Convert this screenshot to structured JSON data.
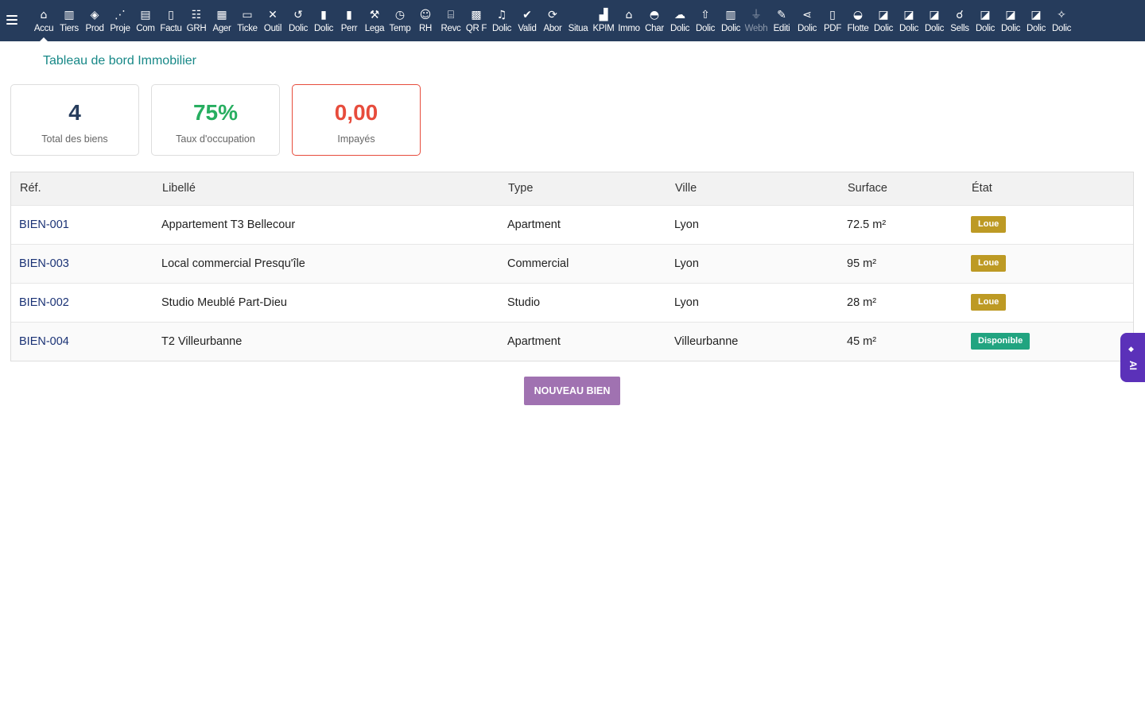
{
  "topbar": {
    "colors": {
      "background": "#263c5c",
      "icon": "#ffffff"
    },
    "menu": [
      {
        "label": "Accu",
        "icon": "home-icon",
        "glyph": "⌂",
        "active": true
      },
      {
        "label": "Tiers",
        "icon": "building-icon",
        "glyph": "▥"
      },
      {
        "label": "Prod",
        "icon": "cube-icon",
        "glyph": "◈"
      },
      {
        "label": "Proje",
        "icon": "project-icon",
        "glyph": "⋰"
      },
      {
        "label": "Com",
        "icon": "briefcase-icon",
        "glyph": "▤"
      },
      {
        "label": "Factu",
        "icon": "invoice-icon",
        "glyph": "▯"
      },
      {
        "label": "GRH",
        "icon": "users-icon",
        "glyph": "☷"
      },
      {
        "label": "Ager",
        "icon": "calendar-icon",
        "glyph": "▦"
      },
      {
        "label": "Ticke",
        "icon": "ticket-icon",
        "glyph": "▭"
      },
      {
        "label": "Outil",
        "icon": "tools-icon",
        "glyph": "✕"
      },
      {
        "label": "Dolic",
        "icon": "undo-icon",
        "glyph": "↺"
      },
      {
        "label": "Dolic",
        "icon": "module-icon",
        "glyph": "▮"
      },
      {
        "label": "Perr",
        "icon": "module-icon",
        "glyph": "▮"
      },
      {
        "label": "Lega",
        "icon": "gavel-icon",
        "glyph": "⚒"
      },
      {
        "label": "Temp",
        "icon": "clock-icon",
        "glyph": "◷"
      },
      {
        "label": "RH",
        "icon": "people-icon",
        "glyph": "☺"
      },
      {
        "label": "Revc",
        "icon": "bank-icon",
        "glyph": "⌸"
      },
      {
        "label": "QR F",
        "icon": "qrcode-icon",
        "glyph": "▩"
      },
      {
        "label": "Dolic",
        "icon": "bell-icon",
        "glyph": "♫"
      },
      {
        "label": "Valid",
        "icon": "check-double-icon",
        "glyph": "✔"
      },
      {
        "label": "Abor",
        "icon": "refresh-icon",
        "glyph": "⟳"
      },
      {
        "label": "Situa",
        "icon": "module-icon",
        "glyph": " "
      },
      {
        "label": "KPIM",
        "icon": "bar-chart-icon",
        "glyph": "▟"
      },
      {
        "label": "Immo",
        "icon": "house-icon",
        "glyph": "⌂"
      },
      {
        "label": "Char",
        "icon": "helmet-icon",
        "glyph": "◓"
      },
      {
        "label": "Dolic",
        "icon": "cloud-icon",
        "glyph": "☁"
      },
      {
        "label": "Dolic",
        "icon": "upload-icon",
        "glyph": "⇧"
      },
      {
        "label": "Dolic",
        "icon": "building-icon",
        "glyph": "▥"
      },
      {
        "label": "Webh",
        "icon": "plug-icon",
        "glyph": "⏚",
        "dim": true
      },
      {
        "label": "Editi",
        "icon": "edit-icon",
        "glyph": "✎"
      },
      {
        "label": "Dolic",
        "icon": "share-icon",
        "glyph": "⋖"
      },
      {
        "label": "PDF",
        "icon": "pdf-icon",
        "glyph": "▯"
      },
      {
        "label": "Flotte",
        "icon": "car-icon",
        "glyph": "◒"
      },
      {
        "label": "Dolic",
        "icon": "note-icon",
        "glyph": "◪"
      },
      {
        "label": "Dolic",
        "icon": "note-icon",
        "glyph": "◪"
      },
      {
        "label": "Dolic",
        "icon": "note-icon",
        "glyph": "◪"
      },
      {
        "label": "Sells",
        "icon": "handshake-icon",
        "glyph": "☌"
      },
      {
        "label": "Dolic",
        "icon": "note-icon",
        "glyph": "◪"
      },
      {
        "label": "Dolic",
        "icon": "note-icon",
        "glyph": "◪"
      },
      {
        "label": "Dolic",
        "icon": "note-icon",
        "glyph": "◪"
      },
      {
        "label": "Dolic",
        "icon": "magic-wand-icon",
        "glyph": "✧"
      }
    ]
  },
  "page": {
    "title": "Tableau de bord Immobilier"
  },
  "kpis": {
    "total": {
      "value": "4",
      "label": "Total des biens",
      "color": "#263c5c"
    },
    "occupancy": {
      "value": "75%",
      "label": "Taux d'occupation",
      "color": "#27ae60"
    },
    "unpaid": {
      "value": "0,00",
      "label": "Impayés",
      "color": "#e74c3c"
    }
  },
  "table": {
    "headers": {
      "ref": "Réf.",
      "label": "Libellé",
      "type": "Type",
      "city": "Ville",
      "surface": "Surface",
      "state": "État"
    },
    "rows": [
      {
        "ref": "BIEN-001",
        "label": "Appartement T3 Bellecour",
        "type": "Apartment",
        "city": "Lyon",
        "surface": "72.5 m²",
        "state": "Loue",
        "state_color": "#bd9a24"
      },
      {
        "ref": "BIEN-003",
        "label": "Local commercial Presqu'île",
        "type": "Commercial",
        "city": "Lyon",
        "surface": "95 m²",
        "state": "Loue",
        "state_color": "#bd9a24"
      },
      {
        "ref": "BIEN-002",
        "label": "Studio Meublé Part-Dieu",
        "type": "Studio",
        "city": "Lyon",
        "surface": "28 m²",
        "state": "Loue",
        "state_color": "#bd9a24"
      },
      {
        "ref": "BIEN-004",
        "label": "T2 Villeurbanne",
        "type": "Apartment",
        "city": "Villeurbanne",
        "surface": "45 m²",
        "state": "Disponible",
        "state_color": "#21a480"
      }
    ]
  },
  "actions": {
    "new_property": "NOUVEAU BIEN",
    "color": "#a072b1"
  },
  "ai_panel": {
    "label": "AI",
    "icon": "sparkle-icon",
    "color": "#5b31b9"
  }
}
